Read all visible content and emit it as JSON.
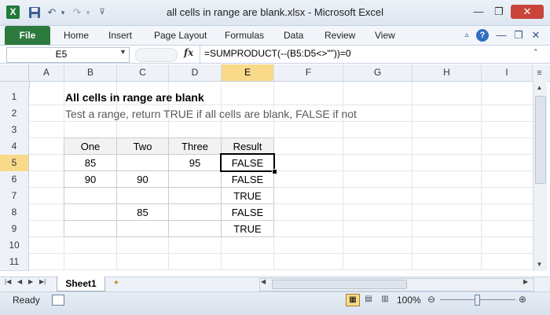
{
  "window": {
    "title": "all cells in range are blank.xlsx  -  Microsoft Excel",
    "minimize": "—",
    "restore": "❐",
    "close": "✕"
  },
  "quick_access": {
    "app_icon": "X",
    "save_icon": "floppy-disk",
    "undo_icon": "undo-arrow",
    "redo_icon": "redo-arrow",
    "customize_icon": "dropdown"
  },
  "ribbon": {
    "file": "File",
    "tabs": [
      "Home",
      "Insert",
      "Page Layout",
      "Formulas",
      "Data",
      "Review",
      "View"
    ]
  },
  "formula_bar": {
    "name_box": "E5",
    "fx": "fx",
    "formula": "=SUMPRODUCT(--(B5:D5<>\"\"))=0"
  },
  "columns": [
    "A",
    "B",
    "C",
    "D",
    "E",
    "F",
    "G",
    "H",
    "I"
  ],
  "rows": [
    "1",
    "2",
    "3",
    "4",
    "5",
    "6",
    "7",
    "8",
    "9",
    "10",
    "11"
  ],
  "sheet": {
    "title": "All cells in range are blank",
    "subtitle": "Test a range, return TRUE if all cells are blank, FALSE if not",
    "table": {
      "headers": [
        "One",
        "Two",
        "Three",
        "Result"
      ],
      "rows": [
        [
          "85",
          "",
          "95",
          "FALSE"
        ],
        [
          "90",
          "90",
          "",
          "FALSE"
        ],
        [
          "",
          "",
          "",
          "TRUE"
        ],
        [
          "",
          "85",
          "",
          "FALSE"
        ],
        [
          "",
          "",
          "",
          "TRUE"
        ]
      ]
    }
  },
  "sheet_tabs": {
    "active": "Sheet1"
  },
  "status": {
    "ready": "Ready",
    "zoom": "100%"
  }
}
